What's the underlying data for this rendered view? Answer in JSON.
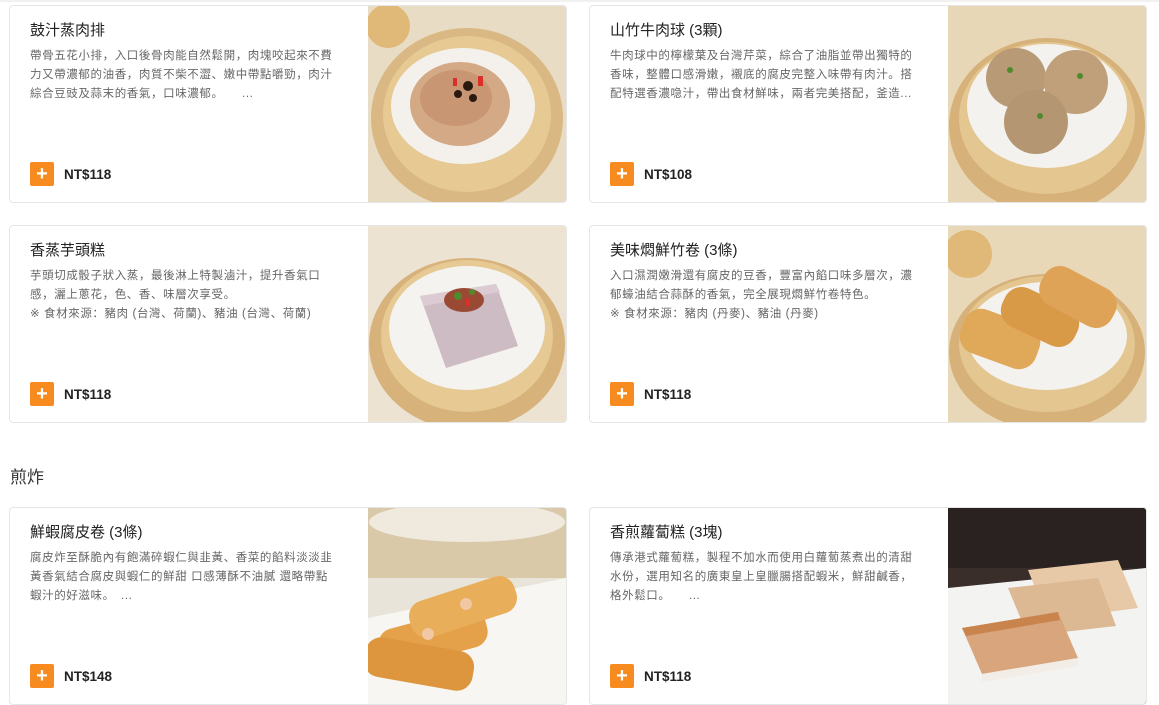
{
  "items": [
    {
      "title": "鼓汁蒸肉排",
      "desc": "帶骨五花小排，入口後骨肉能自然鬆開，肉塊咬起來不費\n力又帶濃郁的油香，肉質不柴不澀、嫩中帶點嚼勁，肉汁\n綜合豆豉及蒜末的香氣，口味濃郁。　　...",
      "price": "NT$118",
      "image": "spareribs-photo"
    },
    {
      "title": "山竹牛肉球 (3顆)",
      "desc": "牛肉球中的檸檬葉及台灣芹菜，綜合了油脂並帶出獨特的\n香味，整體口感滑嫩，襯底的腐皮完整入味帶有肉汁。搭\n配特選香濃喼汁，帶出食材鮮味，兩者完美搭配，釜造...",
      "price": "NT$108",
      "image": "beef-ball-photo"
    },
    {
      "title": "香蒸芋頭糕",
      "desc": "芋頭切成骰子狀入蒸，最後淋上特製滷汁，提升香氣口\n感，灑上蔥花，色、香、味層次享受。\n※ 食材來源：豬肉 (台灣、荷蘭)、豬油 (台灣、荷蘭)",
      "price": "NT$118",
      "image": "taro-cake-photo"
    },
    {
      "title": "美味燜鮮竹卷 (3條)",
      "desc": "入口濕潤嫩滑還有腐皮的豆香，豐富內餡口味多層次，濃\n郁蠔油結合蒜酥的香氣，完全展現燜鮮竹卷特色。\n※ 食材來源：豬肉 (丹麥)、豬油 (丹麥)",
      "price": "NT$118",
      "image": "bean-curd-roll-photo"
    },
    {
      "title": "鮮蝦腐皮卷 (3條)",
      "desc": "腐皮炸至酥脆內有飽滿碎蝦仁與韭黃、香菜的餡料淡淡韭\n黃香氣結合腐皮與蝦仁的鮮甜 口感薄酥不油膩 還略帶點\n蝦汁的好滋味。　...",
      "price": "NT$148",
      "image": "shrimp-roll-photo"
    },
    {
      "title": "香煎蘿蔔糕 (3塊)",
      "desc": "傳承港式蘿蔔糕，製程不加水而使用白蘿蔔蒸煮出的清甜\n水份，選用知名的廣東皇上皇臘腸搭配蝦米，鮮甜鹹香，\n格外鬆口。　　...",
      "price": "NT$118",
      "image": "turnip-cake-photo"
    }
  ],
  "section": {
    "title": "煎炸"
  },
  "add_symbol": "+",
  "colors": {
    "accent": "#f78b1f",
    "border": "#e6e6e6",
    "desc": "#666666"
  }
}
